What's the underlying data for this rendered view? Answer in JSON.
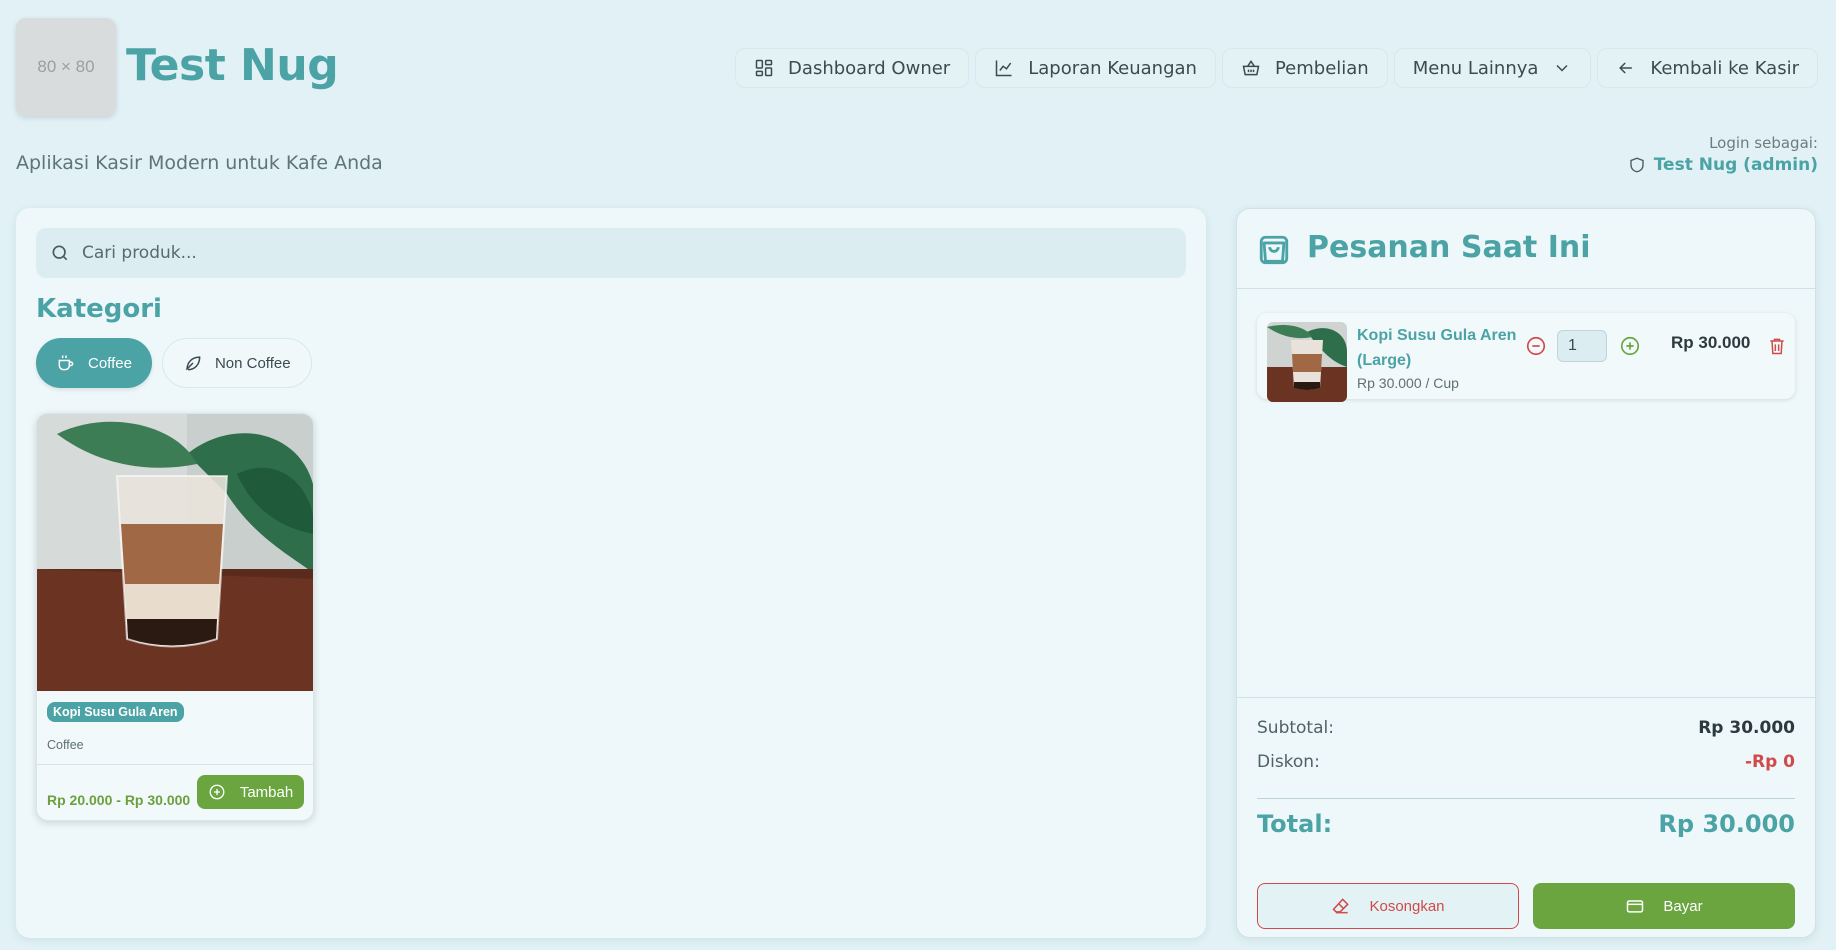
{
  "header": {
    "logo_placeholder": "80 × 80",
    "title": "Test Nug",
    "subtitle": "Aplikasi Kasir Modern untuk Kafe Anda"
  },
  "nav": {
    "dashboard": "Dashboard Owner",
    "laporan": "Laporan Keuangan",
    "pembelian": "Pembelian",
    "menu_lainnya": "Menu Lainnya",
    "kembali": "Kembali ke Kasir"
  },
  "login": {
    "label": "Login sebagai:",
    "user": "Test Nug (admin)"
  },
  "search": {
    "placeholder": "Cari produk..."
  },
  "kategori": {
    "title": "Kategori",
    "items": [
      {
        "label": "Coffee",
        "icon": "coffee-icon",
        "active": true
      },
      {
        "label": "Non Coffee",
        "icon": "leaf-icon",
        "active": false
      }
    ]
  },
  "products": [
    {
      "name": "Kopi Susu Gula Aren",
      "category": "Coffee",
      "price_range": "Rp 20.000 - Rp 30.000",
      "add_label": "Tambah"
    }
  ],
  "order": {
    "title": "Pesanan Saat Ini",
    "items": [
      {
        "name": "Kopi Susu Gula Aren (Large)",
        "unit_price": "Rp 30.000 / Cup",
        "qty": "1",
        "price": "Rp 30.000"
      }
    ],
    "subtotal_label": "Subtotal:",
    "subtotal_value": "Rp 30.000",
    "discount_label": "Diskon:",
    "discount_value": "-Rp 0",
    "total_label": "Total:",
    "total_value": "Rp 30.000",
    "clear_label": "Kosongkan",
    "pay_label": "Bayar"
  },
  "colors": {
    "accent": "#4ba3a5",
    "success": "#6aa540",
    "danger": "#d14a4a",
    "background": "#e1f1f5"
  }
}
